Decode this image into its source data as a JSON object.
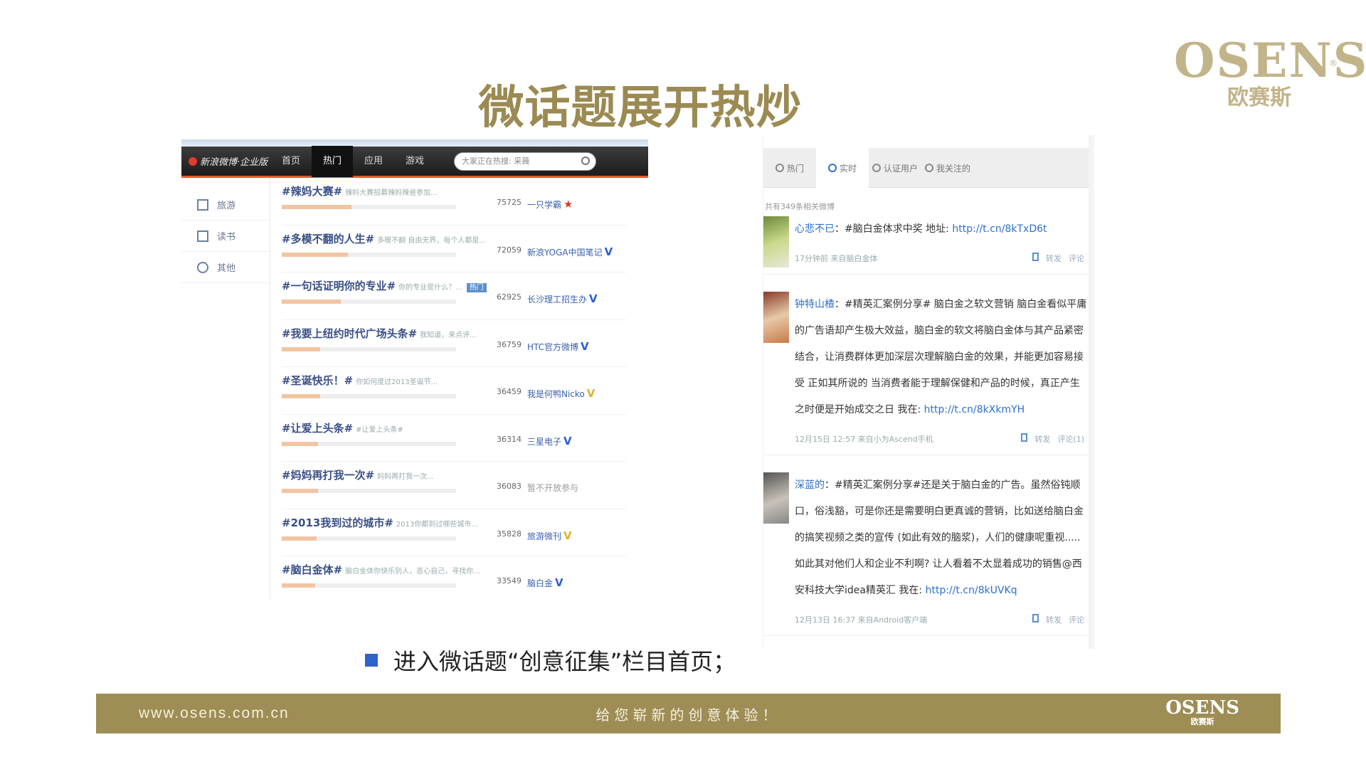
{
  "brand": {
    "mark": "OSENS",
    "reg": "®",
    "sub": "欧赛斯"
  },
  "slide_title": "微话题展开热炒",
  "left_screenshot": {
    "brand": "新浪微博·企业版",
    "nav": [
      {
        "label": "首页",
        "active": false
      },
      {
        "label": "热门",
        "active": true
      },
      {
        "label": "应用",
        "active": false
      },
      {
        "label": "游戏",
        "active": false
      }
    ],
    "search_placeholder": "大家正在热搜: 采薇",
    "side_items": [
      "旅游",
      "读书",
      "其他"
    ],
    "topics": [
      {
        "title": "#辣妈大赛#",
        "desc": "辣妈大赛招募辣妈辣爸参加...",
        "count": "75725",
        "host": "一只学霸",
        "badge": "★",
        "badge_color": "red",
        "progress": 40,
        "tag": ""
      },
      {
        "title": "#多模不翻的人生#",
        "desc": "多模不翻 自由无界，每个人都是...",
        "count": "72059",
        "host": "新浪YOGA中国笔记",
        "badge": "V",
        "badge_color": "blue",
        "progress": 38,
        "tag": ""
      },
      {
        "title": "#一句话证明你的专业#",
        "desc": "你的专业是什么？...",
        "count": "62925",
        "host": "长沙理工招生办",
        "badge": "V",
        "badge_color": "blue",
        "progress": 34,
        "tag": "热门"
      },
      {
        "title": "#我要上纽约时代广场头条#",
        "desc": "我知道，来点评...",
        "count": "36759",
        "host": "HTC官方微博",
        "badge": "V",
        "badge_color": "blue",
        "progress": 22,
        "tag": ""
      },
      {
        "title": "#圣诞快乐！#",
        "desc": "你如何度过2013圣诞节...",
        "count": "36459",
        "host": "我是何鸭Nicko",
        "badge": "V",
        "badge_color": "gold",
        "progress": 22,
        "tag": ""
      },
      {
        "title": "#让爱上头条#",
        "desc": "#让爱上头条#",
        "count": "36314",
        "host": "三星电子",
        "badge": "V",
        "badge_color": "blue",
        "progress": 21,
        "tag": ""
      },
      {
        "title": "#妈妈再打我一次#",
        "desc": "妈妈再打我一次...",
        "count": "36083",
        "host": "暂不开放参与",
        "badge": "",
        "badge_color": "muted",
        "progress": 21,
        "tag": ""
      },
      {
        "title": "#2013我到过的城市#",
        "desc": "2013你都到过哪些城市...",
        "count": "35828",
        "host": "旅游微刊",
        "badge": "V",
        "badge_color": "gold",
        "progress": 20,
        "tag": ""
      },
      {
        "title": "#脑白金体#",
        "desc": "脑白金体你快乐别人，恶心自己，寻找你...",
        "count": "33549",
        "host": "脑白金",
        "badge": "V",
        "badge_color": "blue",
        "progress": 19,
        "tag": ""
      }
    ]
  },
  "right_screenshot": {
    "tabs": [
      {
        "label": "热门",
        "active": false
      },
      {
        "label": "实时",
        "active": true
      },
      {
        "label": "认证用户",
        "active": false
      },
      {
        "label": "我关注的",
        "active": false
      }
    ],
    "section_label": "共有349条相关微博",
    "posts": [
      {
        "name": "心悲不已",
        "text": "：#脑白金体求中奖 地址: ",
        "link": "http://t.cn/8kTxD6t",
        "meta": "17分钟前  来自脑白金体",
        "actions": [
          "转发",
          "评论"
        ]
      },
      {
        "name": "钟特山楂",
        "text": "：#精英汇案例分享# 脑白金之软文营销 脑白金看似平庸的广告语却产生极大效益，脑白金的软文将脑白金体与其产品紧密结合，让消费群体更加深层次理解脑白金的效果，并能更加容易接受 正如其所说的 当消费者能于理解保健和产品的时候，真正产生之时便是开始成交之日 我在: ",
        "link": "http://t.cn/8kXkmYH",
        "meta": "12月15日 12:57  来自小为Ascend手机",
        "actions": [
          "转发",
          "评论(1)"
        ]
      },
      {
        "name": "深蓝的",
        "text": "：#精英汇案例分享#还是关于脑白金的广告。虽然俗钝顺口，俗浅豁，可是你还是需要明白更真诚的营销，比如送给脑白金的搞笑视频之类的宣传 (如此有效的脑浆)，人们的健康呢重视.....如此其对他们人和企业不利啊? 让人看着不太显着成功的销售@西安科技大学idea精英汇 我在: ",
        "link": "http://t.cn/8kUVKq",
        "meta": "12月13日 16:37  来自Android客户端",
        "actions": [
          "转发",
          "评论"
        ]
      }
    ]
  },
  "caption": "进入微话题“创意征集”栏目首页；",
  "footer": {
    "url": "www.osens.com.cn",
    "slogan": "给您崭新的创意体验！",
    "logo_mark": "OSENS",
    "logo_sub": "欧赛斯"
  },
  "colors": {
    "gold": "#9e8d54",
    "logo_gold": "#c2b48a",
    "title_gold": "#9b8a52",
    "link_blue": "#2c6fd0",
    "bullet_blue": "#2e64c8"
  }
}
